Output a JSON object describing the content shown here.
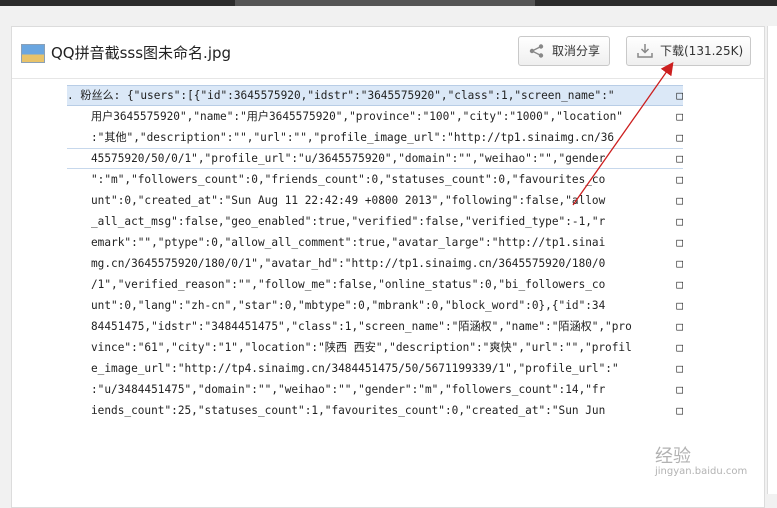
{
  "file": {
    "name": "QQ拼音截sss图未命名.jpg"
  },
  "buttons": {
    "share": "取消分享",
    "download": "下载(131.25K)"
  },
  "code_lines": [
    ". 粉丝么: {\"users\":[{\"id\":3645575920,\"idstr\":\"3645575920\",\"class\":1,\"screen_name\":\"",
    "用户3645575920\",\"name\":\"用户3645575920\",\"province\":\"100\",\"city\":\"1000\",\"location\"",
    ":\"其他\",\"description\":\"\",\"url\":\"\",\"profile_image_url\":\"http://tp1.sinaimg.cn/36",
    "45575920/50/0/1\",\"profile_url\":\"u/3645575920\",\"domain\":\"\",\"weihao\":\"\",\"gender",
    "\":\"m\",\"followers_count\":0,\"friends_count\":0,\"statuses_count\":0,\"favourites_co",
    "unt\":0,\"created_at\":\"Sun Aug 11 22:42:49 +0800 2013\",\"following\":false,\"allow",
    "_all_act_msg\":false,\"geo_enabled\":true,\"verified\":false,\"verified_type\":-1,\"r",
    "emark\":\"\",\"ptype\":0,\"allow_all_comment\":true,\"avatar_large\":\"http://tp1.sinai",
    "mg.cn/3645575920/180/0/1\",\"avatar_hd\":\"http://tp1.sinaimg.cn/3645575920/180/0",
    "/1\",\"verified_reason\":\"\",\"follow_me\":false,\"online_status\":0,\"bi_followers_co",
    "unt\":0,\"lang\":\"zh-cn\",\"star\":0,\"mbtype\":0,\"mbrank\":0,\"block_word\":0},{\"id\":34",
    "84451475,\"idstr\":\"3484451475\",\"class\":1,\"screen_name\":\"陌涵权\",\"name\":\"陌涵权\",\"pro",
    "vince\":\"61\",\"city\":\"1\",\"location\":\"陕西 西安\",\"description\":\"爽快\",\"url\":\"\",\"profil",
    "e_image_url\":\"http://tp4.sinaimg.cn/3484451475/50/5671199339/1\",\"profile_url\":\"",
    ":\"u/3484451475\",\"domain\":\"\",\"weihao\":\"\",\"gender\":\"m\",\"followers_count\":14,\"fr",
    "iends_count\":25,\"statuses_count\":1,\"favourites_count\":0,\"created_at\":\"Sun Jun"
  ],
  "watermark": {
    "text": "经验",
    "sub": "jingyan.baidu.com"
  },
  "colors": {
    "arrow": "#cc1f1f",
    "highlight": "#dbe8f7"
  }
}
